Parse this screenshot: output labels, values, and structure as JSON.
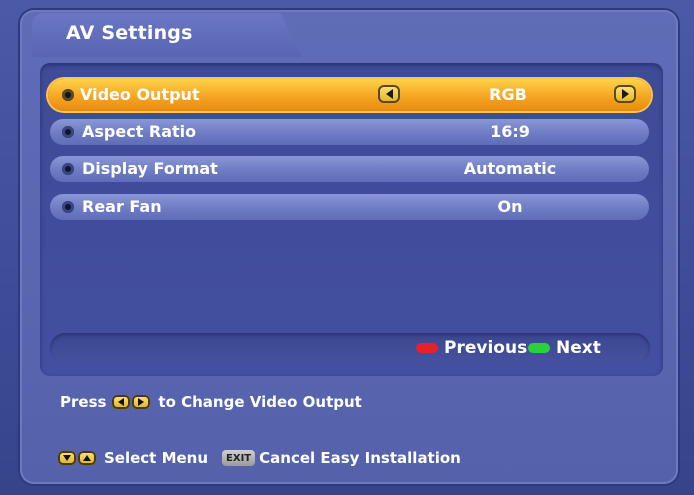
{
  "window": {
    "title": "AV Settings"
  },
  "menu": {
    "rows": [
      {
        "label": "Video Output",
        "value": "RGB",
        "selected": true
      },
      {
        "label": "Aspect Ratio",
        "value": "16:9",
        "selected": false
      },
      {
        "label": "Display Format",
        "value": "Automatic",
        "selected": false
      },
      {
        "label": "Rear Fan",
        "value": "On",
        "selected": false
      }
    ]
  },
  "nav": {
    "previous_label": "Previous",
    "next_label": "Next",
    "previous_color": "#e8202a",
    "next_color": "#2ad23a"
  },
  "hint": {
    "press_label": "Press",
    "action_label": "to Change Video Output"
  },
  "footer": {
    "select_menu_label": "Select Menu",
    "exit_key_label": "EXIT",
    "cancel_label": "Cancel Easy Installation"
  },
  "icons": {
    "row_bullet": "circle-bullet-icon",
    "left_arrow": "left-arrow-icon",
    "right_arrow": "right-arrow-icon",
    "up_arrow": "up-arrow-icon",
    "down_arrow": "down-arrow-icon"
  },
  "colors": {
    "background": "#3a4a92",
    "panel": "#5f6cb7",
    "selected_row": "#f5a623",
    "row": "#6e7cc4"
  }
}
